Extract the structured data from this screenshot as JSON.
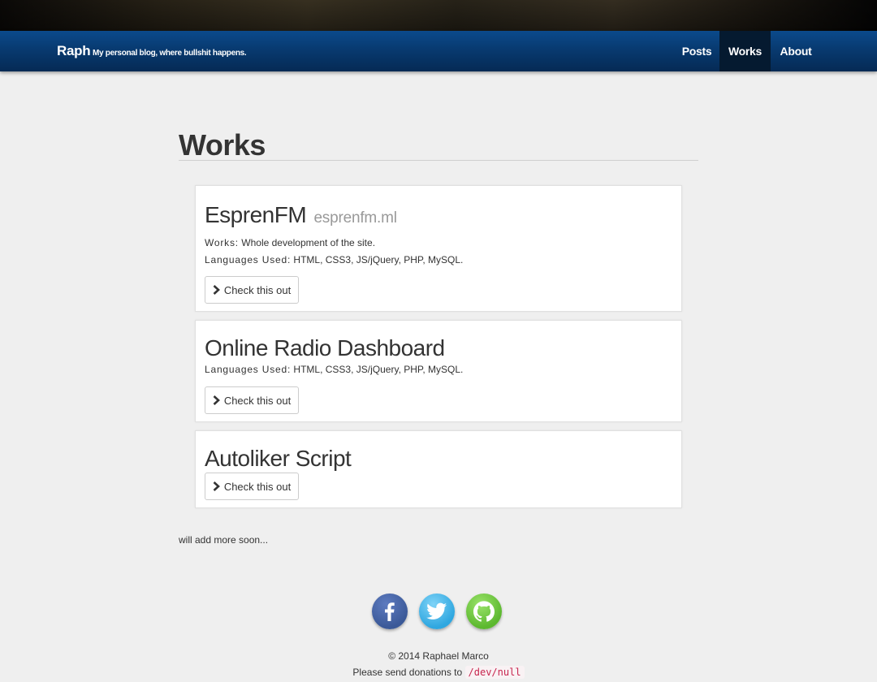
{
  "navbar": {
    "brand": "Raph",
    "tagline": "My personal blog, where bullshit happens.",
    "items": [
      {
        "label": "Posts",
        "active": false
      },
      {
        "label": "Works",
        "active": true
      },
      {
        "label": "About",
        "active": false
      }
    ],
    "accent_color": "#083a70"
  },
  "page": {
    "title": "Works"
  },
  "works": [
    {
      "title": "EsprenFM",
      "domain": "esprenfm.ml",
      "works_label": "Works:",
      "works_value": "Whole development of the site.",
      "languages_label": "Languages Used:",
      "languages_value": "HTML, CSS3, JS/jQuery, PHP, MySQL.",
      "button": "Check this out"
    },
    {
      "title": "Online Radio Dashboard",
      "languages_label": "Languages Used:",
      "languages_value": "HTML, CSS3, JS/jQuery, PHP, MySQL.",
      "button": "Check this out"
    },
    {
      "title": "Autoliker Script",
      "button": "Check this out"
    }
  ],
  "more_note": "will add more soon...",
  "social": [
    {
      "icon": "facebook-icon",
      "color": "#3b5998"
    },
    {
      "icon": "twitter-icon",
      "color": "#2fa7e0"
    },
    {
      "icon": "github-icon",
      "color": "#5cb82f"
    }
  ],
  "footer": {
    "copyright": "© 2014 Raphael Marco",
    "donation_text": "Please send donations to",
    "donation_code": "/dev/null"
  }
}
